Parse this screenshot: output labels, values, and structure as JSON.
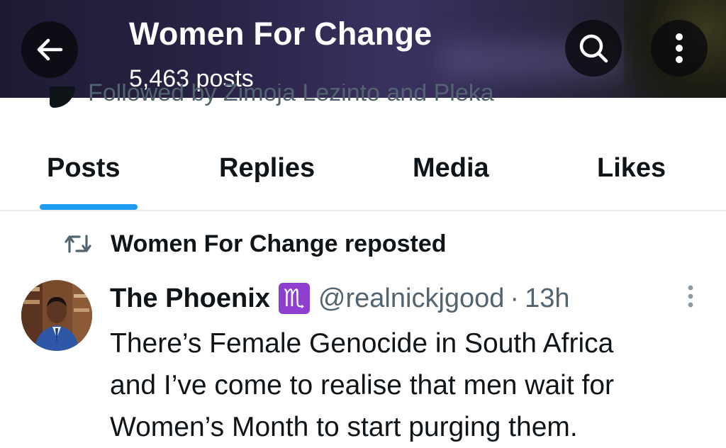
{
  "header": {
    "title": "Women For Change",
    "posts_count": "5,463 posts",
    "back_icon": "arrow-left-icon",
    "search_icon": "search-icon",
    "more_icon": "more-vertical-icon"
  },
  "profile": {
    "followed_by": "Followed by Zimoja Lezinto and Pleka"
  },
  "tabs": [
    {
      "label": "Posts",
      "selected": true
    },
    {
      "label": "Replies",
      "selected": false
    },
    {
      "label": "Media",
      "selected": false
    },
    {
      "label": "Likes",
      "selected": false
    }
  ],
  "feed": {
    "repost_label": "Women For Change reposted",
    "tweet": {
      "display_name": "The Phoenix",
      "zodiac_emoji": "♏",
      "handle": "@realnickjgood",
      "separator": "·",
      "time": "13h",
      "text_lines": [
        "There’s Female Genocide in South Africa",
        "and I’ve come to realise that men wait for",
        "Women’s Month to start purging them."
      ]
    }
  },
  "colors": {
    "accent": "#1d9bf0",
    "secondary_text": "#536471",
    "primary_text": "#0f1419"
  }
}
